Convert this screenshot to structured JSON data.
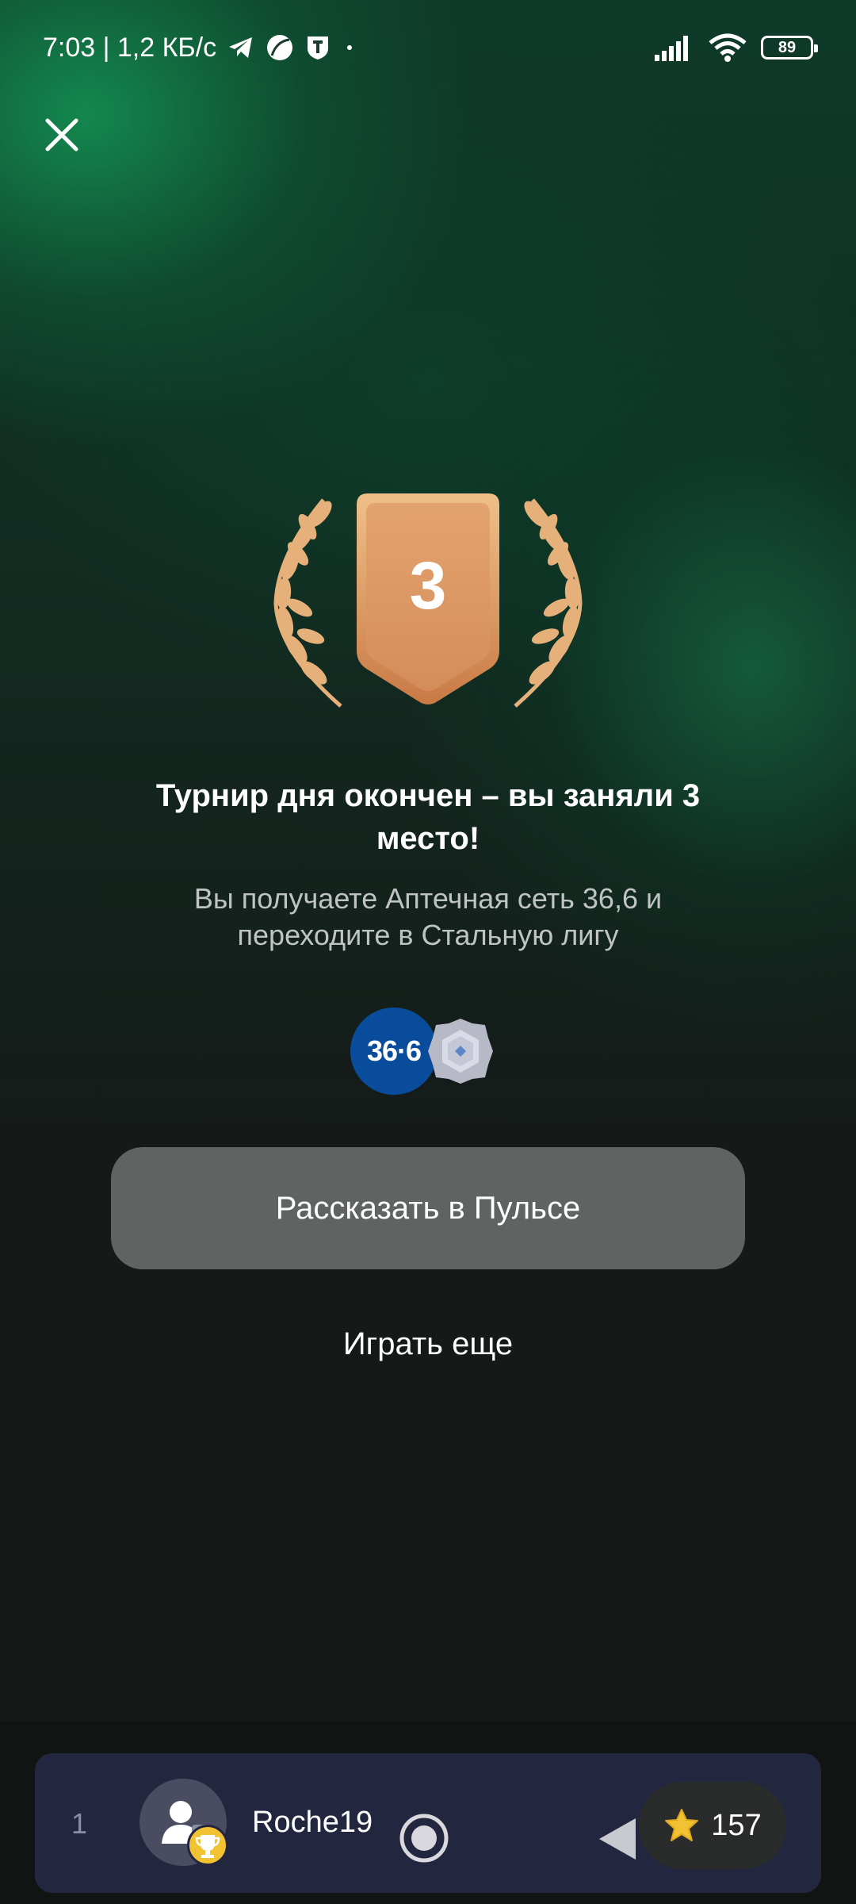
{
  "status_bar": {
    "time_speed": "7:03 | 1,2 КБ/с",
    "battery": "89"
  },
  "result": {
    "place": "3",
    "title": "Турнир дня окончен – вы заняли 3 место!",
    "subtitle": "Вы получаете Аптечная сеть 36,6 и переходите в Стальную лигу",
    "reward_brand_logo": "36·6"
  },
  "actions": {
    "share_label": "Рассказать в Пульсе",
    "play_again_label": "Играть еще"
  },
  "leaderboard_row": {
    "rank": "1",
    "username": "Roche19",
    "score": "157"
  },
  "colors": {
    "accent_green": "#148c50",
    "badge_bronze": "#d9935f",
    "share_button_bg": "#5f6462",
    "card_bg": "#23263f",
    "star": "#f1c232"
  },
  "icons": [
    "telegram-icon",
    "leaf-icon",
    "shield-t-icon",
    "signal-icon",
    "wifi-icon",
    "battery-icon",
    "close-icon",
    "laurel-icon",
    "league-medal-icon",
    "avatar-icon",
    "trophy-icon",
    "record-icon",
    "back-icon",
    "star-icon"
  ]
}
